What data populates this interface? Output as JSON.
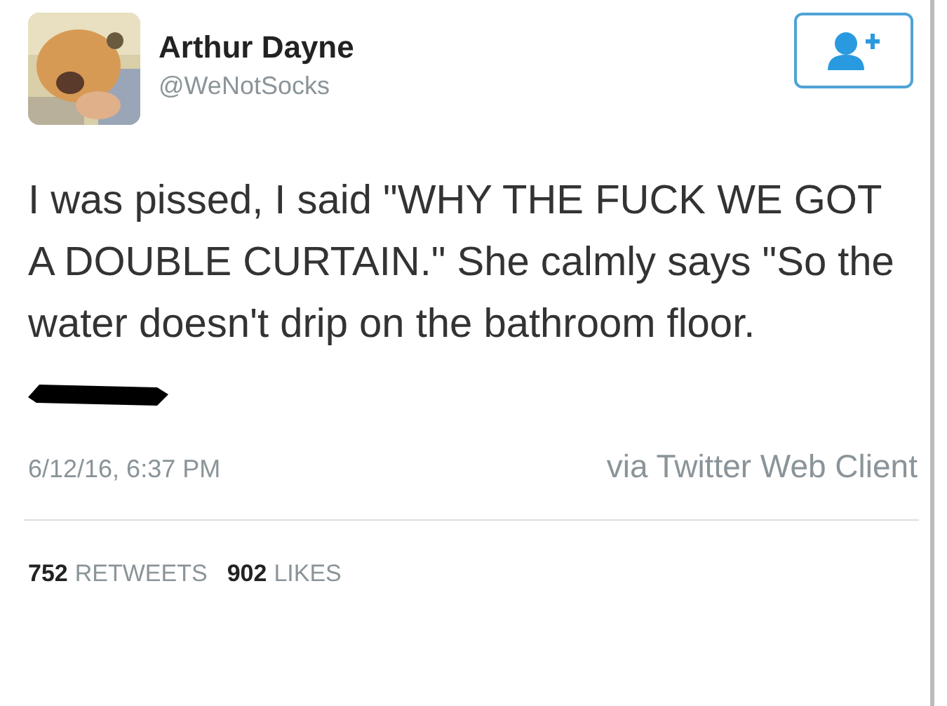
{
  "author": {
    "name": "Arthur Dayne",
    "handle": "@WeNotSocks"
  },
  "tweet": {
    "text": "I was pissed, I said \"WHY THE FUCK WE GOT A DOUBLE CURTAIN.\" She calmly says \"So the water doesn't drip on the bathroom floor.",
    "redacted_line": true
  },
  "meta": {
    "timestamp": "6/12/16, 6:37 PM",
    "source": "via Twitter Web Client"
  },
  "stats": [
    {
      "count": "752",
      "label": "RETWEETS"
    },
    {
      "count": "902",
      "label": "LIKES"
    }
  ]
}
